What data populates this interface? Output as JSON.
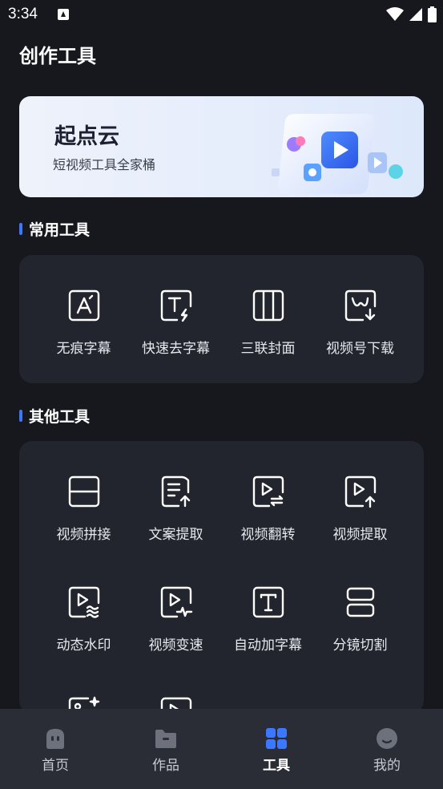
{
  "status_bar": {
    "time": "3:34"
  },
  "page": {
    "title": "创作工具"
  },
  "banner": {
    "title": "起点云",
    "subtitle": "短视频工具全家桶"
  },
  "common_tools": {
    "title": "常用工具",
    "items": [
      {
        "label": "无痕字幕",
        "icon": "text-a-icon"
      },
      {
        "label": "快速去字幕",
        "icon": "text-flash-icon"
      },
      {
        "label": "三联封面",
        "icon": "triple-cover-icon"
      },
      {
        "label": "视频号下载",
        "icon": "video-download-icon"
      }
    ]
  },
  "other_tools": {
    "title": "其他工具",
    "items": [
      {
        "label": "视频拼接",
        "icon": "split-panel-icon"
      },
      {
        "label": "文案提取",
        "icon": "doc-upload-icon"
      },
      {
        "label": "视频翻转",
        "icon": "video-flip-icon"
      },
      {
        "label": "视频提取",
        "icon": "video-upload-icon"
      },
      {
        "label": "动态水印",
        "icon": "video-watermark-icon"
      },
      {
        "label": "视频变速",
        "icon": "video-speed-icon"
      },
      {
        "label": "自动加字幕",
        "icon": "auto-text-icon"
      },
      {
        "label": "分镜切割",
        "icon": "scene-cut-icon"
      }
    ]
  },
  "tabbar": {
    "items": [
      {
        "label": "首页",
        "icon": "home-icon"
      },
      {
        "label": "作品",
        "icon": "folder-icon"
      },
      {
        "label": "工具",
        "icon": "grid-icon",
        "active": true
      },
      {
        "label": "我的",
        "icon": "profile-icon"
      }
    ]
  },
  "colors": {
    "accent": "#3b78ff",
    "background": "#17181d",
    "card": "#22252d",
    "tabbar": "#2a2d35"
  }
}
